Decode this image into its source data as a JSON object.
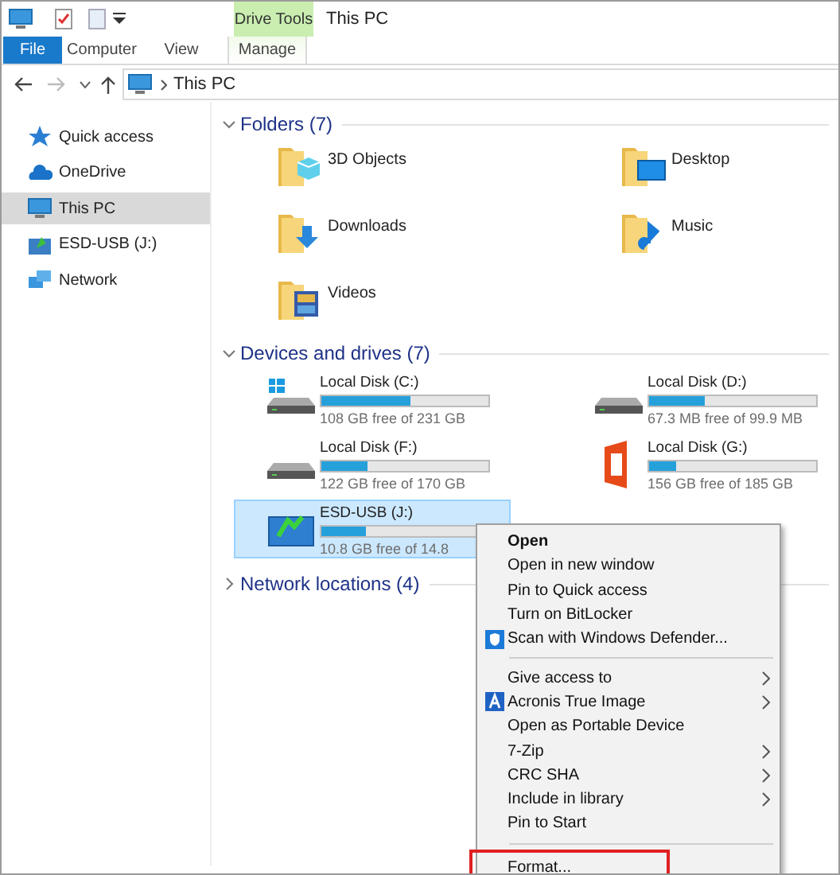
{
  "window": {
    "title": "This PC",
    "context_tab": "Drive Tools"
  },
  "ribbon_tabs": [
    {
      "label": "File",
      "kind": "file",
      "selected": false
    },
    {
      "label": "Computer",
      "kind": "tab",
      "selected": false
    },
    {
      "label": "View",
      "kind": "tab",
      "selected": false
    },
    {
      "label": "Manage",
      "kind": "context",
      "selected": false
    }
  ],
  "address": {
    "path": "This PC"
  },
  "sidebar": {
    "items": [
      {
        "label": "Quick access",
        "kind": "star",
        "selected": false
      },
      {
        "label": "OneDrive",
        "kind": "cloud",
        "selected": false
      },
      {
        "label": "This PC",
        "kind": "pc",
        "selected": true
      },
      {
        "label": "ESD-USB (J:)",
        "kind": "usb",
        "selected": false
      },
      {
        "label": "Network",
        "kind": "network",
        "selected": false
      }
    ]
  },
  "folders": {
    "header": "Folders (7)",
    "expanded": true,
    "items": [
      {
        "label": "3D Objects",
        "kind": "cube"
      },
      {
        "label": "Desktop",
        "kind": "desktop"
      },
      {
        "label": "Downloads",
        "kind": "download"
      },
      {
        "label": "Music",
        "kind": "music"
      },
      {
        "label": "Videos",
        "kind": "video"
      }
    ]
  },
  "drives": {
    "header": "Devices and drives (7)",
    "expanded": true,
    "items": [
      {
        "name": "Local Disk (C:)",
        "kind": "system",
        "level": 0.53,
        "free": "108 GB free of 231 GB",
        "selected": false
      },
      {
        "name": "Local Disk (D:)",
        "kind": "disk",
        "level": 0.33,
        "free": "67.3 MB free of 99.9 MB",
        "selected": false
      },
      {
        "name": "Local Disk (F:)",
        "kind": "disk",
        "level": 0.28,
        "free": "122 GB free of 170 GB",
        "selected": false
      },
      {
        "name": "Local Disk (G:)",
        "kind": "office",
        "level": 0.16,
        "free": "156 GB free of 185 GB",
        "selected": false
      },
      {
        "name": "ESD-USB (J:)",
        "kind": "usb",
        "level": 0.27,
        "free": "10.8 GB free of 14.8",
        "selected": true
      }
    ]
  },
  "network_locations": {
    "header": "Network locations (4)",
    "expanded": false
  },
  "context_menu": {
    "items": [
      {
        "label": "Open",
        "kind": "item",
        "bold": true,
        "submenu": false,
        "highlighted": false
      },
      {
        "label": "Open in new window",
        "kind": "item",
        "bold": false,
        "submenu": false,
        "highlighted": false
      },
      {
        "label": "Pin to Quick access",
        "kind": "item",
        "bold": false,
        "submenu": false,
        "highlighted": false
      },
      {
        "label": "Turn on BitLocker",
        "kind": "item",
        "bold": false,
        "submenu": false,
        "highlighted": false
      },
      {
        "label": "Scan with Windows Defender...",
        "kind": "shield",
        "bold": false,
        "submenu": false,
        "highlighted": false
      },
      {
        "kind": "separator"
      },
      {
        "label": "Give access to",
        "kind": "item",
        "bold": false,
        "submenu": true,
        "highlighted": false
      },
      {
        "label": "Acronis True Image",
        "kind": "acronis",
        "bold": false,
        "submenu": true,
        "highlighted": false
      },
      {
        "label": "Open as Portable Device",
        "kind": "item",
        "bold": false,
        "submenu": false,
        "highlighted": false
      },
      {
        "label": "7-Zip",
        "kind": "item",
        "bold": false,
        "submenu": true,
        "highlighted": false
      },
      {
        "label": "CRC SHA",
        "kind": "item",
        "bold": false,
        "submenu": true,
        "highlighted": false
      },
      {
        "label": "Include in library",
        "kind": "item",
        "bold": false,
        "submenu": true,
        "highlighted": false
      },
      {
        "label": "Pin to Start",
        "kind": "item",
        "bold": false,
        "submenu": false,
        "highlighted": false
      },
      {
        "kind": "separator"
      },
      {
        "label": "Format...",
        "kind": "item",
        "bold": false,
        "submenu": false,
        "highlighted": true
      }
    ]
  }
}
